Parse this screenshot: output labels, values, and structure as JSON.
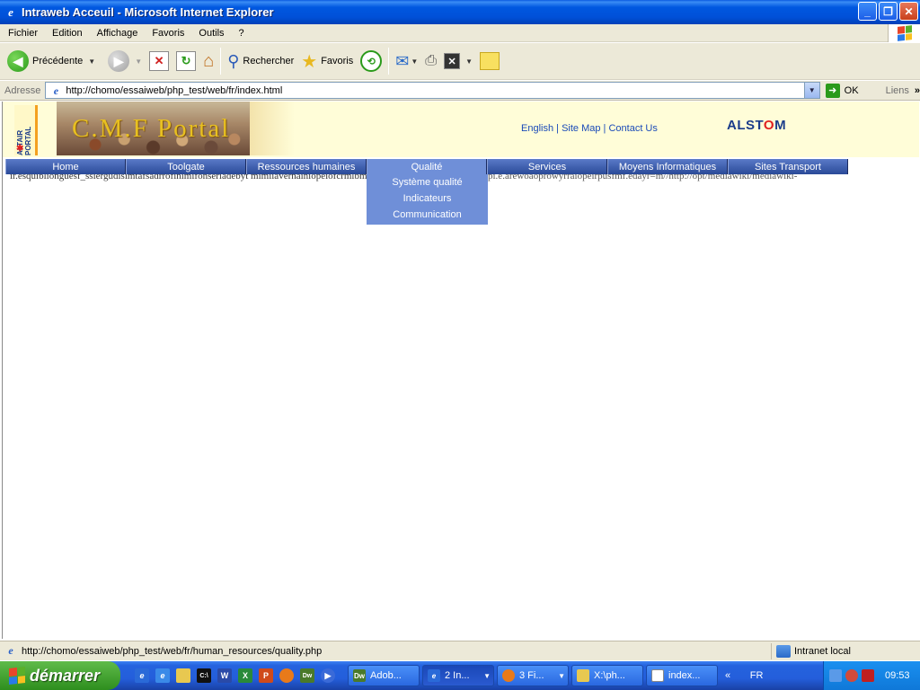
{
  "window": {
    "title": "Intraweb Acceuil - Microsoft Internet Explorer",
    "controls": [
      "minimize",
      "restore",
      "close"
    ]
  },
  "menu": [
    "Fichier",
    "Edition",
    "Affichage",
    "Favoris",
    "Outils",
    "?"
  ],
  "toolbar": {
    "back_label": "Précédente",
    "search_label": "Rechercher",
    "favorites_label": "Favoris"
  },
  "address": {
    "label": "Adresse",
    "url": "http://chomo/essaiweb/php_test/web/fr/index.html",
    "go_label": "OK",
    "links_label": "Liens"
  },
  "page": {
    "altair_text": "ALTAIR PORTAL",
    "portal_title": "C.M.F Portal",
    "top_links": [
      "English",
      "Site Map",
      "Contact Us"
    ],
    "brand_pre": "ALST",
    "brand_o": "O",
    "brand_post": "M",
    "nav": [
      "Home",
      "Toolgate",
      "Ressources humaines",
      "Qualité",
      "Services",
      "Moyens Informatiques",
      "Sites Transport"
    ],
    "active_nav": "Qualité",
    "dropdown": [
      "Système qualité",
      "Indicateurs",
      "Communication"
    ],
    "garbled_left": "ir.esquiblionguesf_ssiergudisimtafsadrrofinimifonseriadebyt mimiiavernainiopeiofcrmlbmon",
    "garbled_right": "pi.e.arewoaoprowyrraiopeirpusfmf.edayr=m//http://opt/mediawiki/mediawiki-"
  },
  "status": {
    "url": "http://chomo/essaiweb/php_test/web/fr/human_resources/quality.php",
    "zone": "Intranet local"
  },
  "taskbar": {
    "start_label": "démarrer",
    "tasks": [
      {
        "icon": "Dw",
        "label": "Adob..."
      },
      {
        "icon": "e",
        "label": "2 In...",
        "active": true
      },
      {
        "icon": "ff",
        "label": "3 Fi..."
      },
      {
        "icon": "folder",
        "label": "X:\\ph..."
      },
      {
        "icon": "notepad",
        "label": "index..."
      }
    ],
    "lang": "FR",
    "clock": "09:53"
  }
}
